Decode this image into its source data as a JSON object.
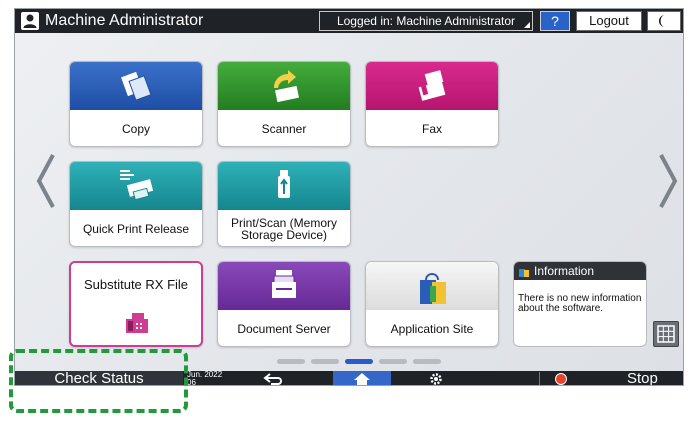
{
  "header": {
    "title": "Machine Administrator",
    "login_status": "Logged in: Machine Administrator",
    "help_label": "?",
    "logout_label": "Logout"
  },
  "tiles": [
    {
      "label": "Copy",
      "color": "#2a5db8",
      "icon": "copy-icon"
    },
    {
      "label": "Scanner",
      "color": "#2e9a2c",
      "icon": "scanner-icon"
    },
    {
      "label": "Fax",
      "color": "#c81f7f",
      "icon": "fax-icon"
    },
    {
      "label": "Quick Print Release",
      "color": "#1f9ca3",
      "icon": "printer-icon"
    },
    {
      "label": "Print/Scan (Memory Storage Device)",
      "color": "#1f9ca3",
      "icon": "usb-icon"
    },
    {
      "label": "Substitute RX File",
      "color": "#cf3d92",
      "icon": "fax-machine-icon"
    },
    {
      "label": "Document Server",
      "color": "#7a3aa8",
      "icon": "document-stack-icon"
    },
    {
      "label": "Application Site",
      "color": "#e0e0e0",
      "icon": "shopping-bag-icon"
    }
  ],
  "info_widget": {
    "title": "Information",
    "body": "There is no new information about the software."
  },
  "bottom": {
    "check_status": "Check Status",
    "date_line1": "Jun. 2022",
    "date_line2": "06",
    "stop_label": "Stop"
  },
  "pagination": {
    "total": 5,
    "current": 3
  }
}
